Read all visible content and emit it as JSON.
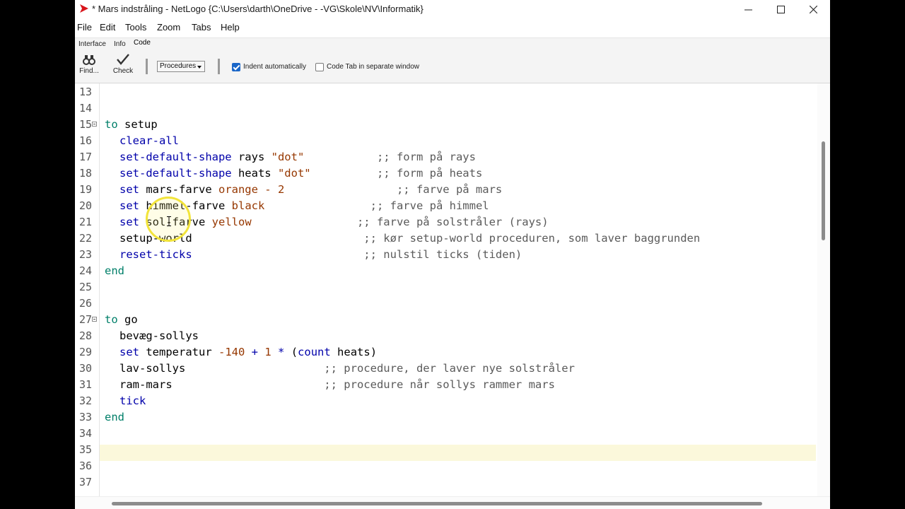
{
  "window": {
    "title": "* Mars indstråling - NetLogo {C:\\Users\\darth\\OneDrive - -VG\\Skole\\NV\\Informatik}",
    "icon": "netlogo-arrow-icon",
    "buttons": [
      "minimize-icon",
      "maximize-icon",
      "close-icon"
    ]
  },
  "menu": [
    "File",
    "Edit",
    "Tools",
    "Zoom",
    "Tabs",
    "Help"
  ],
  "tabs": [
    "Interface",
    "Info",
    "Code"
  ],
  "active_tab": "Code",
  "toolbar": {
    "find_label": "Find...",
    "check_label": "Check",
    "procedures_label": "Procedures",
    "indent_label": "Indent automatically",
    "indent_checked": true,
    "separate_label": "Code Tab in separate window",
    "separate_checked": false
  },
  "editor": {
    "highlight_line": 35,
    "lines": [
      {
        "n": "13",
        "indent": 0,
        "fold": false,
        "tokens": []
      },
      {
        "n": "14",
        "indent": 0,
        "fold": false,
        "tokens": []
      },
      {
        "n": "15",
        "indent": 0,
        "fold": true,
        "tokens": [
          [
            "kw",
            "to"
          ],
          [
            "txt",
            " setup"
          ]
        ]
      },
      {
        "n": "16",
        "indent": 1,
        "fold": false,
        "tokens": [
          [
            "prim",
            "clear-all"
          ]
        ]
      },
      {
        "n": "17",
        "indent": 1,
        "fold": false,
        "tokens": [
          [
            "prim",
            "set-default-shape"
          ],
          [
            "txt",
            " rays "
          ],
          [
            "str",
            "\"dot\""
          ],
          [
            "txt",
            "           "
          ],
          [
            "cmt",
            ";; form på rays"
          ]
        ]
      },
      {
        "n": "18",
        "indent": 1,
        "fold": false,
        "tokens": [
          [
            "prim",
            "set-default-shape"
          ],
          [
            "txt",
            " heats "
          ],
          [
            "str",
            "\"dot\""
          ],
          [
            "txt",
            "          "
          ],
          [
            "cmt",
            ";; form på heats"
          ]
        ]
      },
      {
        "n": "19",
        "indent": 1,
        "fold": false,
        "tokens": [
          [
            "prim",
            "set"
          ],
          [
            "txt",
            " mars-farve "
          ],
          [
            "const",
            "orange - 2"
          ],
          [
            "txt",
            "                 "
          ],
          [
            "cmt",
            ";; farve på mars"
          ]
        ]
      },
      {
        "n": "20",
        "indent": 1,
        "fold": false,
        "tokens": [
          [
            "prim",
            "set"
          ],
          [
            "txt",
            " himmel-farve "
          ],
          [
            "const",
            "black"
          ],
          [
            "txt",
            "                "
          ],
          [
            "cmt",
            ";; farve på himmel"
          ]
        ]
      },
      {
        "n": "21",
        "indent": 1,
        "fold": false,
        "tokens": [
          [
            "prim",
            "set"
          ],
          [
            "txt",
            " sol-farve "
          ],
          [
            "const",
            "yellow"
          ],
          [
            "txt",
            "                "
          ],
          [
            "cmt",
            ";; farve på solstråler (rays)"
          ]
        ]
      },
      {
        "n": "22",
        "indent": 1,
        "fold": false,
        "tokens": [
          [
            "txt",
            "setup-world"
          ],
          [
            "txt",
            "                          "
          ],
          [
            "cmt",
            ";; kør setup-world proceduren, som laver baggrunden"
          ]
        ]
      },
      {
        "n": "23",
        "indent": 1,
        "fold": false,
        "tokens": [
          [
            "prim",
            "reset-ticks"
          ],
          [
            "txt",
            "                          "
          ],
          [
            "cmt",
            ";; nulstil ticks (tiden)"
          ]
        ]
      },
      {
        "n": "24",
        "indent": 0,
        "fold": false,
        "tokens": [
          [
            "kw",
            "end"
          ]
        ]
      },
      {
        "n": "25",
        "indent": 0,
        "fold": false,
        "tokens": []
      },
      {
        "n": "26",
        "indent": 0,
        "fold": false,
        "tokens": []
      },
      {
        "n": "27",
        "indent": 0,
        "fold": true,
        "tokens": [
          [
            "kw",
            "to"
          ],
          [
            "txt",
            " go"
          ]
        ]
      },
      {
        "n": "28",
        "indent": 1,
        "fold": false,
        "tokens": [
          [
            "txt",
            "bevæg-sollys"
          ]
        ]
      },
      {
        "n": "29",
        "indent": 1,
        "fold": false,
        "tokens": [
          [
            "prim",
            "set"
          ],
          [
            "txt",
            " temperatur "
          ],
          [
            "const",
            "-140"
          ],
          [
            "txt",
            " "
          ],
          [
            "prim",
            "+"
          ],
          [
            "txt",
            " "
          ],
          [
            "const",
            "1"
          ],
          [
            "txt",
            " "
          ],
          [
            "prim",
            "*"
          ],
          [
            "txt",
            " ("
          ],
          [
            "prim",
            "count"
          ],
          [
            "txt",
            " heats)"
          ]
        ]
      },
      {
        "n": "30",
        "indent": 1,
        "fold": false,
        "tokens": [
          [
            "txt",
            "lav-sollys"
          ],
          [
            "txt",
            "                     "
          ],
          [
            "cmt",
            ";; procedure, der laver nye solstråler"
          ]
        ]
      },
      {
        "n": "31",
        "indent": 1,
        "fold": false,
        "tokens": [
          [
            "txt",
            "ram-mars"
          ],
          [
            "txt",
            "                       "
          ],
          [
            "cmt",
            ";; procedure når sollys rammer mars"
          ]
        ]
      },
      {
        "n": "32",
        "indent": 1,
        "fold": false,
        "tokens": [
          [
            "prim",
            "tick"
          ]
        ]
      },
      {
        "n": "33",
        "indent": 0,
        "fold": false,
        "tokens": [
          [
            "kw",
            "end"
          ]
        ]
      },
      {
        "n": "34",
        "indent": 0,
        "fold": false,
        "tokens": []
      },
      {
        "n": "35",
        "indent": 0,
        "fold": false,
        "tokens": []
      },
      {
        "n": "36",
        "indent": 0,
        "fold": false,
        "tokens": []
      },
      {
        "n": "37",
        "indent": 0,
        "fold": false,
        "tokens": []
      }
    ]
  },
  "colors": {
    "keyword": "#007f69",
    "primitive": "#0000aa",
    "constant": "#963700",
    "comment": "#5a5a5a",
    "current_line": "#fbf8db",
    "cursor_ring": "#f2e43a"
  }
}
